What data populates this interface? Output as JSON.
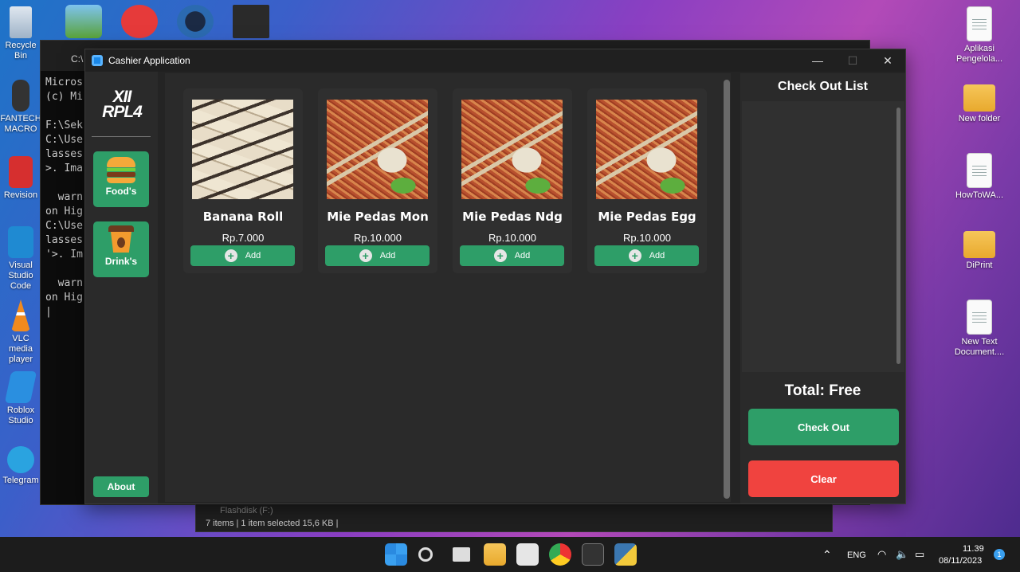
{
  "desktop": {
    "left_icons": [
      "Recycle Bin",
      "FANTECH MACRO",
      "Revision",
      "Visual Studio Code",
      "VLC media player",
      "Roblox Studio",
      "Telegram"
    ],
    "right_icons": [
      "Aplikasi Pengelola...",
      "New folder",
      "HowToWA...",
      "DiPrint",
      "New Text Document...."
    ]
  },
  "terminal": {
    "title": "C:\\",
    "lines": "Micros\n(c) Mi\n\nF:\\Sek\nC:\\Use\nlasses\n>. Ima\n\n  warn\non Hig\nC:\\Use\nlasses\n'>. Im\n\n  warn\non Hig\n|"
  },
  "explorer": {
    "status": "7 items  |  1 item selected  15,6 KB  |",
    "drive": "Flashdisk (F:)"
  },
  "window": {
    "title": "Cashier Application",
    "minimize": "—",
    "maximize": "☐",
    "close": "✕"
  },
  "sidebar": {
    "logo_line1": "XII",
    "logo_line2": "RPL4",
    "categories": [
      {
        "label": "Food's",
        "icon": "burger-icon"
      },
      {
        "label": "Drink's",
        "icon": "coffee-cup-icon"
      }
    ],
    "about_label": "About"
  },
  "menu": {
    "items": [
      {
        "name": "Banana Roll",
        "price": "Rp.7.000",
        "add_label": "Add"
      },
      {
        "name": "Mie Pedas Mon",
        "price": "Rp.10.000",
        "add_label": "Add"
      },
      {
        "name": "Mie Pedas Ndg",
        "price": "Rp.10.000",
        "add_label": "Add"
      },
      {
        "name": "Mie Pedas Egg",
        "price": "Rp.10.000",
        "add_label": "Add"
      }
    ]
  },
  "checkout": {
    "title": "Check Out List",
    "total": "Total: Free",
    "checkout_label": "Check Out",
    "clear_label": "Clear"
  },
  "taskbar": {
    "lang": "ENG",
    "time": "11.39",
    "date": "08/11/2023",
    "notifications": "1"
  },
  "colors": {
    "accent_green": "#2e9e68",
    "danger_red": "#f0433f",
    "panel_bg": "#2a2a2a"
  }
}
